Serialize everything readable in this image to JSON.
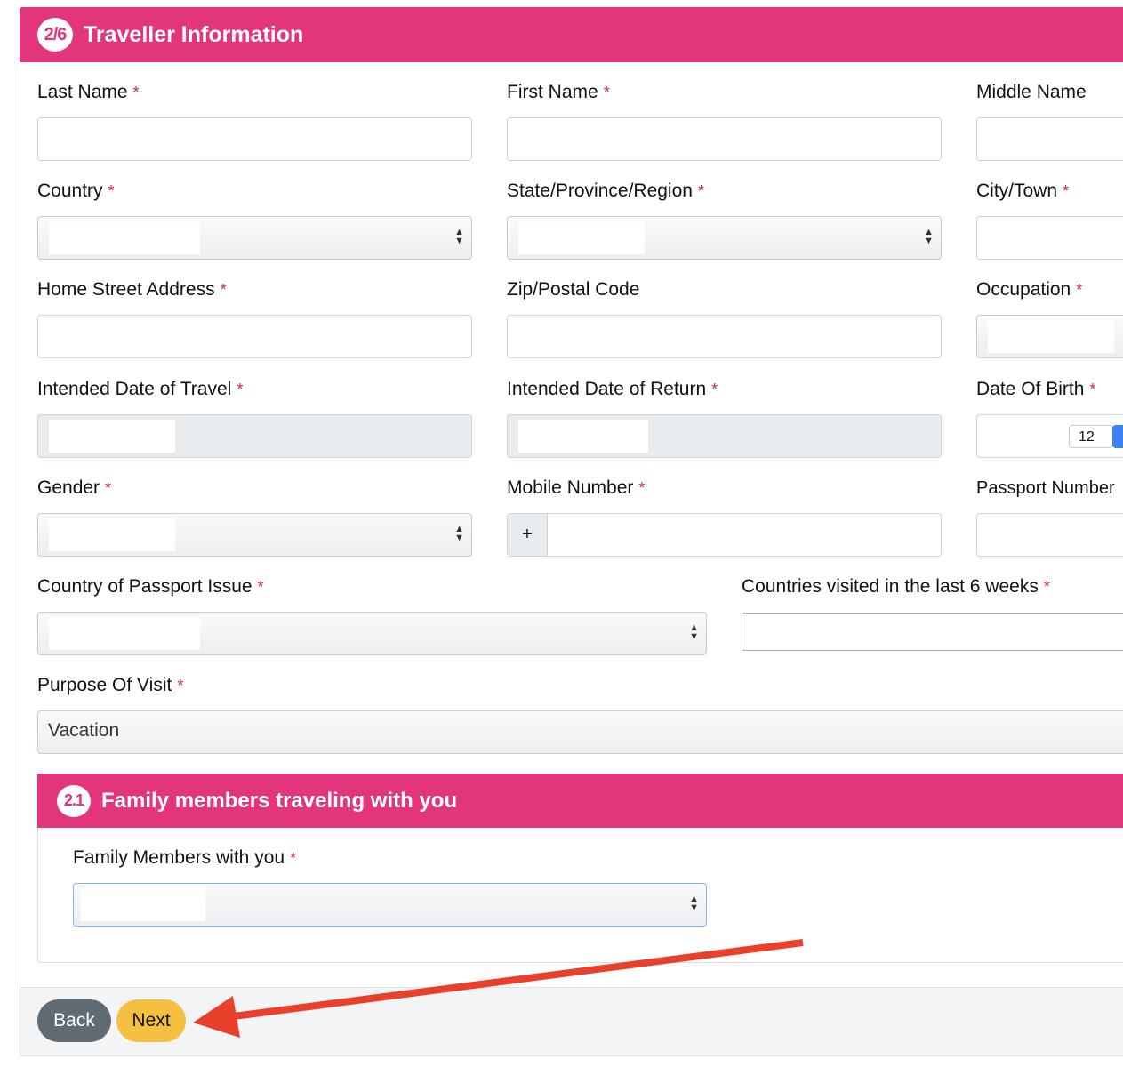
{
  "header": {
    "step": "2/6",
    "title": "Traveller Information"
  },
  "fields": {
    "last_name": "Last Name",
    "first_name": "First Name",
    "middle_name": "Middle Name",
    "country": "Country",
    "state": "State/Province/Region",
    "city": "City/Town",
    "street": "Home Street Address",
    "zip": "Zip/Postal Code",
    "occupation": "Occupation",
    "travel_date": "Intended Date of Travel",
    "return_date": "Intended Date of Return",
    "dob": "Date Of Birth",
    "gender": "Gender",
    "mobile": "Mobile Number",
    "passport": "Passport Number",
    "passport_country": "Country of Passport Issue",
    "countries_visited": "Countries visited in the last 6 weeks",
    "purpose": "Purpose Of Visit"
  },
  "values": {
    "dob_day": "12",
    "mobile_prefix": "+",
    "purpose": "Vacation"
  },
  "required_mark": "*",
  "family": {
    "step": "2.1",
    "title": "Family members traveling with you",
    "label": "Family Members with you"
  },
  "buttons": {
    "back": "Back",
    "next": "Next"
  },
  "colors": {
    "accent": "#e2357c",
    "next": "#f5c042",
    "back": "#606b73",
    "arrow": "#e8402a"
  }
}
